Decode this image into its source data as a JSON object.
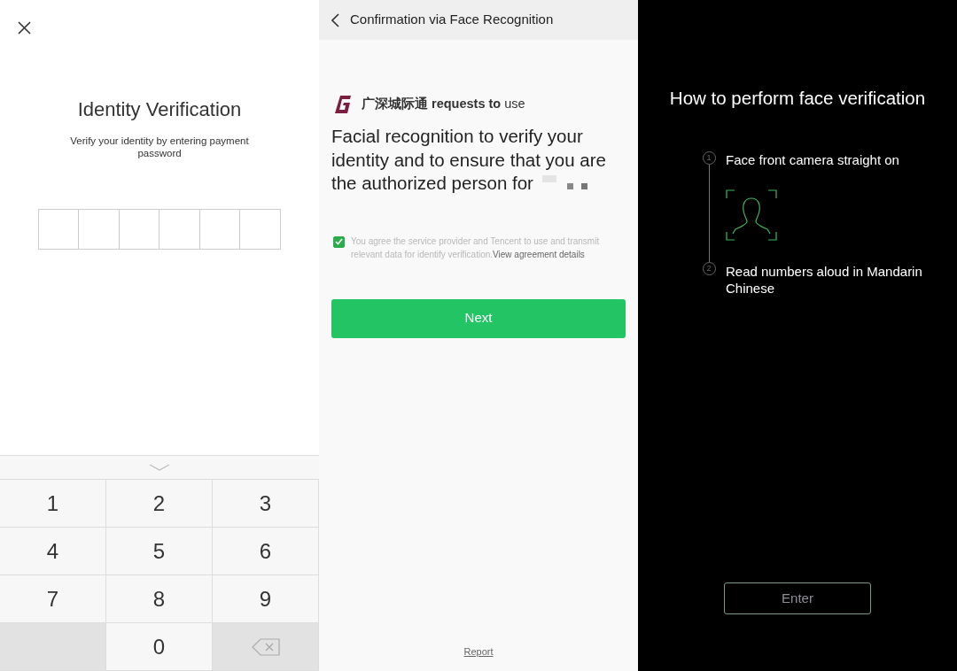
{
  "password_screen": {
    "title": "Identity Verification",
    "subtitle": "Verify your identity by entering payment password",
    "pin_boxes": [
      {
        "filled": false
      },
      {
        "filled": false
      },
      {
        "filled": false
      },
      {
        "filled": false
      },
      {
        "filled": false
      },
      {
        "filled": false
      }
    ],
    "keypad": [
      {
        "kind": "digit",
        "label": "1"
      },
      {
        "kind": "digit",
        "label": "2"
      },
      {
        "kind": "digit",
        "label": "3"
      },
      {
        "kind": "digit",
        "label": "4"
      },
      {
        "kind": "digit",
        "label": "5"
      },
      {
        "kind": "digit",
        "label": "6"
      },
      {
        "kind": "digit",
        "label": "7"
      },
      {
        "kind": "digit",
        "label": "8"
      },
      {
        "kind": "digit",
        "label": "9"
      },
      {
        "kind": "blank"
      },
      {
        "kind": "digit",
        "label": "0"
      },
      {
        "kind": "backspace"
      }
    ]
  },
  "face_confirmation": {
    "header_title": "Confirmation via Face Recognition",
    "request_line": "**广深城际通 requests to** use",
    "description": "Facial recognition to verify your identity and to ensure that you are the authorized person for",
    "agreement": {
      "checked": true,
      "text": "You agree the service provider and Tencent to use and transmit relevant data for identify verification.",
      "link": "View agreement details"
    },
    "next_button": "Next",
    "report_link": "Report"
  },
  "face_guide": {
    "title": "How to perform face verification",
    "steps": [
      {
        "number": "1",
        "text": "Face front camera straight on"
      },
      {
        "number": "2",
        "text": "Read numbers aloud in Mandarin Chinese"
      }
    ],
    "enter_button": "Enter"
  }
}
